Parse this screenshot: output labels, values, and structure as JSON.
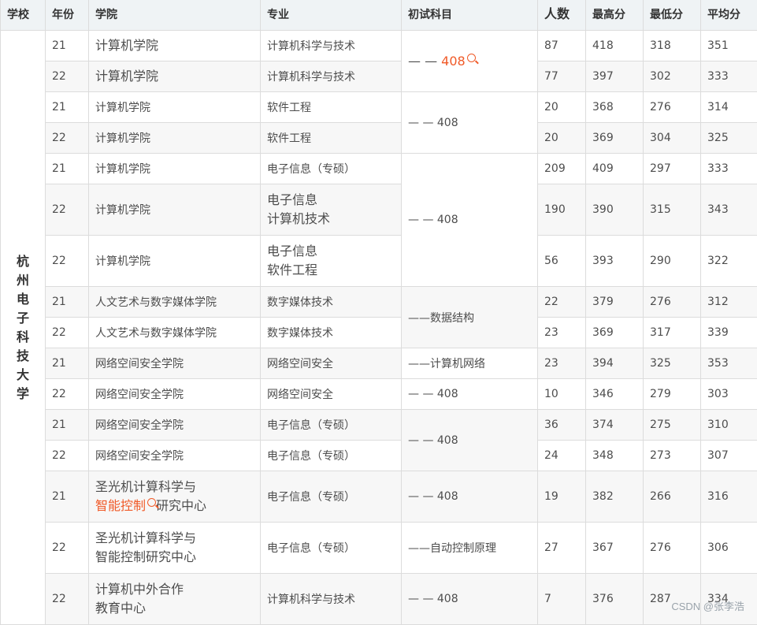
{
  "headers": {
    "school": "学校",
    "year": "年份",
    "college": "学院",
    "major": "专业",
    "subject": "初试科目",
    "count": "人数",
    "max": "最高分",
    "min": "最低分",
    "avg": "平均分"
  },
  "school": "杭州电子科技大学",
  "accent_color": "#f05a28",
  "subjects": [
    "— — ",
    "408",
    "— — 408",
    "— — 408",
    "——数据结构",
    "——计算机网络",
    "— — 408",
    "— — 408",
    "— — 408",
    "——自动控制原理",
    "— — 408"
  ],
  "rows": [
    {
      "year": "21",
      "college": "计算机学院",
      "major": "计算机科学与技术",
      "count": "87",
      "max": "418",
      "min": "318",
      "avg": "351"
    },
    {
      "year": "22",
      "college": "计算机学院",
      "major": "计算机科学与技术",
      "count": "77",
      "max": "397",
      "min": "302",
      "avg": "333"
    },
    {
      "year": "21",
      "college": "计算机学院",
      "major": "软件工程",
      "count": "20",
      "max": "368",
      "min": "276",
      "avg": "314"
    },
    {
      "year": "22",
      "college": "计算机学院",
      "major": "软件工程",
      "count": "20",
      "max": "369",
      "min": "304",
      "avg": "325"
    },
    {
      "year": "21",
      "college": "计算机学院",
      "major": "电子信息（专硕）",
      "count": "209",
      "max": "409",
      "min": "297",
      "avg": "333"
    },
    {
      "year": "22",
      "college": "计算机学院",
      "major": "电子信息",
      "major2": "计算机技术",
      "count": "190",
      "max": "390",
      "min": "315",
      "avg": "343"
    },
    {
      "year": "22",
      "college": "计算机学院",
      "major": "电子信息",
      "major2": "软件工程",
      "count": "56",
      "max": "393",
      "min": "290",
      "avg": "322"
    },
    {
      "year": "21",
      "college": "人文艺术与数字媒体学院",
      "major": "数字媒体技术",
      "count": "22",
      "max": "379",
      "min": "276",
      "avg": "312"
    },
    {
      "year": "22",
      "college": "人文艺术与数字媒体学院",
      "major": "数字媒体技术",
      "count": "23",
      "max": "369",
      "min": "317",
      "avg": "339"
    },
    {
      "year": "21",
      "college": "网络空间安全学院",
      "major": "网络空间安全",
      "count": "23",
      "max": "394",
      "min": "325",
      "avg": "353"
    },
    {
      "year": "22",
      "college": "网络空间安全学院",
      "major": "网络空间安全",
      "count": "10",
      "max": "346",
      "min": "279",
      "avg": "303"
    },
    {
      "year": "21",
      "college": "网络空间安全学院",
      "major": "电子信息（专硕）",
      "count": "36",
      "max": "374",
      "min": "275",
      "avg": "310"
    },
    {
      "year": "22",
      "college": "网络空间安全学院",
      "major": "电子信息（专硕）",
      "count": "24",
      "max": "348",
      "min": "273",
      "avg": "307"
    },
    {
      "year": "21",
      "college": "圣光机计算科学与",
      "college_link": "智能控制",
      "college_tail": "研究中心",
      "major": "电子信息（专硕）",
      "count": "19",
      "max": "382",
      "min": "266",
      "avg": "316"
    },
    {
      "year": "22",
      "college": "圣光机计算科学与",
      "college2": "智能控制研究中心",
      "major": "电子信息（专硕）",
      "count": "27",
      "max": "367",
      "min": "276",
      "avg": "306"
    },
    {
      "year": "22",
      "college": "计算机中外合作",
      "college2": "教育中心",
      "major": "计算机科学与技术",
      "count": "7",
      "max": "376",
      "min": "287",
      "avg": "334"
    }
  ],
  "watermark": "CSDN @张李浩"
}
